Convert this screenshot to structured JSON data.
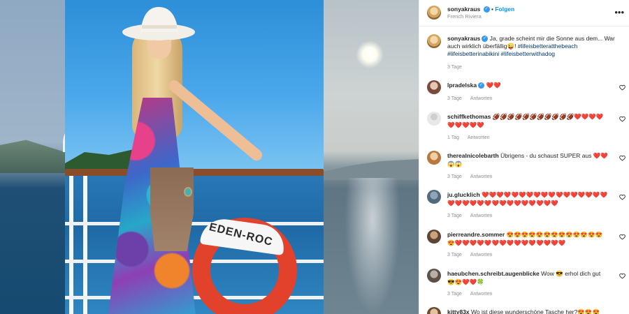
{
  "post": {
    "username": "sonyakraus",
    "follow_label": "Folgen",
    "location": "French Riviera",
    "ring_text": "EDEN-ROC"
  },
  "caption": {
    "username": "sonyakraus",
    "text": "Ja, grade scheint mir die Sonne aus dem... War auch wirklich überfällig😜!",
    "hashtags": "#lifeisbetteratthebeach #lifeisbetterinabikini #lifeisbetterwithadog",
    "time": "3 Tage"
  },
  "comments": [
    {
      "username": "lpradelska",
      "verified": true,
      "text": "❤️❤️",
      "time": "3 Tage",
      "reply": "Antworten"
    },
    {
      "username": "schiffkethomas",
      "verified": false,
      "text": "🏈🏈🏈🏈🏈🏈🏈🏈🏈🏈🏈❤️❤️❤️❤️❤️❤️❤️❤️❤️",
      "time": "1 Tag",
      "reply": "Antworten"
    },
    {
      "username": "therealnicolebarth",
      "verified": false,
      "text": "Übrigens - du schaust SUPER aus ❤️❤️😱😱",
      "time": "3 Tage",
      "reply": "Antworten"
    },
    {
      "username": "ju.glucklich",
      "verified": false,
      "text": "❤️❤️❤️❤️❤️❤️❤️❤️❤️❤️❤️❤️❤️❤️❤️❤️❤️❤️❤️❤️❤️❤️❤️❤️❤️❤️❤️❤️❤️❤️❤️❤️",
      "time": "3 Tage",
      "reply": "Antworten"
    },
    {
      "username": "pierreandre.sommer",
      "verified": false,
      "text": "😍😍😍😍😍😍😍😍😍😍😍😍😍😍❤️❤️❤️❤️❤️❤️❤️❤️❤️❤️❤️❤️❤️❤️❤️",
      "time": "3 Tage",
      "reply": "Antworten"
    },
    {
      "username": "haeubchen.schreibt.augenblicke",
      "verified": false,
      "text": "Wow 😎 erhol dich gut 😎😍❤️❤️🍀",
      "time": "3 Tage",
      "reply": "Antworten"
    },
    {
      "username": "kitty83x",
      "verified": false,
      "text": "Wo ist diese wunderschöne Tasche her?😍😍😍",
      "time": "",
      "reply": ""
    }
  ],
  "colors": {
    "link": "#00376b",
    "follow": "#0095f6",
    "verified": "#3897f0",
    "meta": "#8e8e8e"
  },
  "icons": {
    "more": "more-options-icon",
    "like": "heart-icon",
    "verified": "verified-badge-icon"
  }
}
